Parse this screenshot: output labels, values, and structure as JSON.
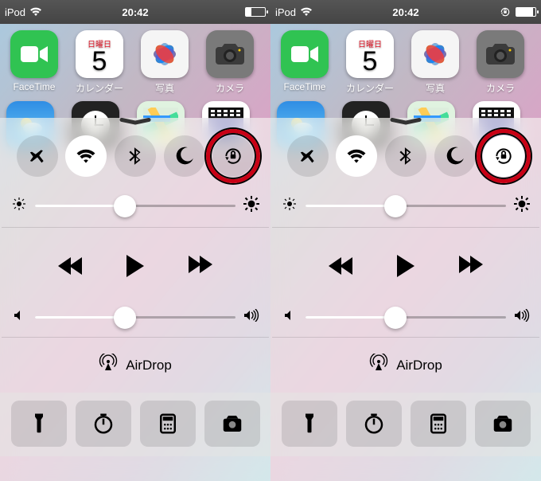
{
  "status": {
    "carrier_left": "iPod",
    "time_left": "20:42",
    "carrier_right": "iPod",
    "time_right": "20:42",
    "battery_left_pct": 30,
    "battery_right_pct": 88,
    "rotation_lock_badge_right": true
  },
  "apps": {
    "facetime": "FaceTime",
    "calendar": "カレンダー",
    "calendar_weekday": "日曜日",
    "calendar_day": "5",
    "photos": "写真",
    "camera": "カメラ"
  },
  "control_center": {
    "toggles": {
      "airplane": {
        "on_left": false,
        "on_right": false
      },
      "wifi": {
        "on_left": true,
        "on_right": true
      },
      "bluetooth": {
        "on_left": false,
        "on_right": false
      },
      "dnd": {
        "on_left": false,
        "on_right": false
      },
      "rotation_lock": {
        "on_left": false,
        "on_right": true,
        "highlighted": true
      }
    },
    "brightness_pct_left": 45,
    "brightness_pct_right": 45,
    "volume_pct_left": 45,
    "volume_pct_right": 45,
    "airdrop_label": "AirDrop"
  },
  "annotation": {
    "circle_targets": "rotation-lock toggle on both panes",
    "circle_color": "#c80015"
  }
}
